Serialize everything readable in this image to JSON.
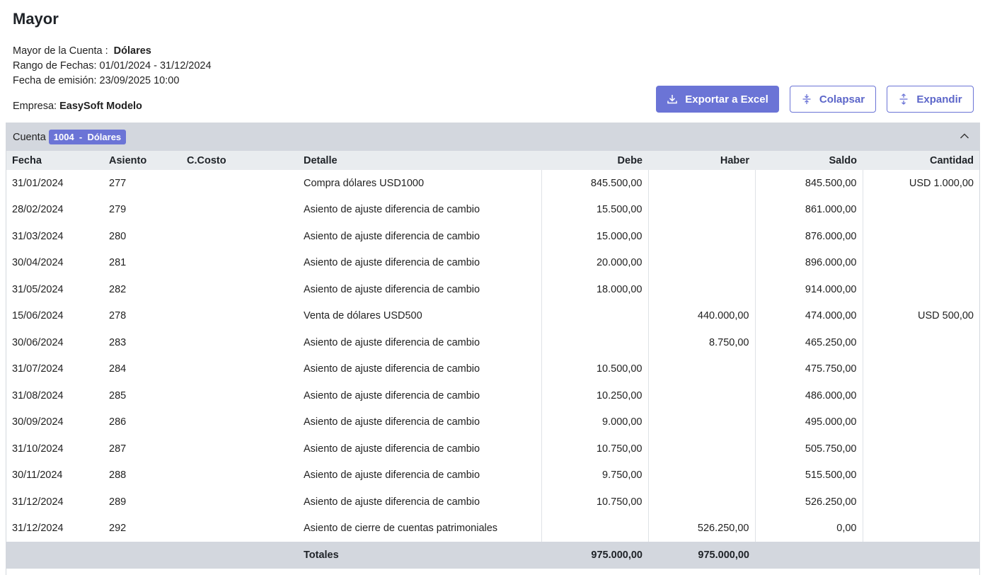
{
  "page": {
    "title": "Mayor",
    "cuenta_label": "Mayor de la Cuenta :",
    "cuenta_name": "Dólares",
    "rango_label": "Rango de Fechas:",
    "rango_value": "01/01/2024 - 31/12/2024",
    "emision_label": "Fecha de emisión:",
    "emision_value": "23/09/2025 10:00",
    "empresa_label": "Empresa:",
    "empresa_value": "EasySoft Modelo"
  },
  "actions": {
    "export_label": "Exportar a Excel",
    "collapse_label": "Colapsar",
    "expand_label": "Expandir"
  },
  "account": {
    "label": "Cuenta",
    "badge": "1004  -  Dólares"
  },
  "columns": {
    "fecha": "Fecha",
    "asiento": "Asiento",
    "ccosto": "C.Costo",
    "detalle": "Detalle",
    "debe": "Debe",
    "haber": "Haber",
    "saldo": "Saldo",
    "cantidad": "Cantidad"
  },
  "rows": [
    {
      "fecha": "31/01/2024",
      "asiento": "277",
      "ccosto": "",
      "detalle": "Compra dólares USD1000",
      "debe": "845.500,00",
      "haber": "",
      "saldo": "845.500,00",
      "cantidad": "USD 1.000,00"
    },
    {
      "fecha": "28/02/2024",
      "asiento": "279",
      "ccosto": "",
      "detalle": "Asiento de ajuste diferencia de cambio",
      "debe": "15.500,00",
      "haber": "",
      "saldo": "861.000,00",
      "cantidad": ""
    },
    {
      "fecha": "31/03/2024",
      "asiento": "280",
      "ccosto": "",
      "detalle": "Asiento de ajuste diferencia de cambio",
      "debe": "15.000,00",
      "haber": "",
      "saldo": "876.000,00",
      "cantidad": ""
    },
    {
      "fecha": "30/04/2024",
      "asiento": "281",
      "ccosto": "",
      "detalle": "Asiento de ajuste diferencia de cambio",
      "debe": "20.000,00",
      "haber": "",
      "saldo": "896.000,00",
      "cantidad": ""
    },
    {
      "fecha": "31/05/2024",
      "asiento": "282",
      "ccosto": "",
      "detalle": "Asiento de ajuste diferencia de cambio",
      "debe": "18.000,00",
      "haber": "",
      "saldo": "914.000,00",
      "cantidad": ""
    },
    {
      "fecha": "15/06/2024",
      "asiento": "278",
      "ccosto": "",
      "detalle": "Venta de dólares USD500",
      "debe": "",
      "haber": "440.000,00",
      "saldo": "474.000,00",
      "cantidad": "USD 500,00"
    },
    {
      "fecha": "30/06/2024",
      "asiento": "283",
      "ccosto": "",
      "detalle": "Asiento de ajuste diferencia de cambio",
      "debe": "",
      "haber": "8.750,00",
      "saldo": "465.250,00",
      "cantidad": ""
    },
    {
      "fecha": "31/07/2024",
      "asiento": "284",
      "ccosto": "",
      "detalle": "Asiento de ajuste diferencia de cambio",
      "debe": "10.500,00",
      "haber": "",
      "saldo": "475.750,00",
      "cantidad": ""
    },
    {
      "fecha": "31/08/2024",
      "asiento": "285",
      "ccosto": "",
      "detalle": "Asiento de ajuste diferencia de cambio",
      "debe": "10.250,00",
      "haber": "",
      "saldo": "486.000,00",
      "cantidad": ""
    },
    {
      "fecha": "30/09/2024",
      "asiento": "286",
      "ccosto": "",
      "detalle": "Asiento de ajuste diferencia de cambio",
      "debe": "9.000,00",
      "haber": "",
      "saldo": "495.000,00",
      "cantidad": ""
    },
    {
      "fecha": "31/10/2024",
      "asiento": "287",
      "ccosto": "",
      "detalle": "Asiento de ajuste diferencia de cambio",
      "debe": "10.750,00",
      "haber": "",
      "saldo": "505.750,00",
      "cantidad": ""
    },
    {
      "fecha": "30/11/2024",
      "asiento": "288",
      "ccosto": "",
      "detalle": "Asiento de ajuste diferencia de cambio",
      "debe": "9.750,00",
      "haber": "",
      "saldo": "515.500,00",
      "cantidad": ""
    },
    {
      "fecha": "31/12/2024",
      "asiento": "289",
      "ccosto": "",
      "detalle": "Asiento de ajuste diferencia de cambio",
      "debe": "10.750,00",
      "haber": "",
      "saldo": "526.250,00",
      "cantidad": ""
    },
    {
      "fecha": "31/12/2024",
      "asiento": "292",
      "ccosto": "",
      "detalle": "Asiento de cierre de cuentas patrimoniales",
      "debe": "",
      "haber": "526.250,00",
      "saldo": "0,00",
      "cantidad": ""
    }
  ],
  "totals": {
    "label": "Totales",
    "debe": "975.000,00",
    "haber": "975.000,00"
  },
  "icons": {
    "export": "download-icon",
    "collapse": "collapse-icon",
    "expand": "expand-icon",
    "panel_toggle": "chevron-up-icon"
  },
  "colors": {
    "accent": "#6b74d6",
    "header_bg": "#d3d7de",
    "column_header_bg": "#e9ecef"
  }
}
